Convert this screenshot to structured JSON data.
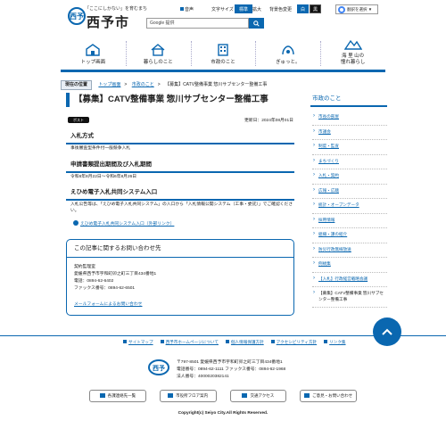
{
  "header": {
    "tagline": "「ここにしかない」を育むまち",
    "site_name": "西予市",
    "logo_text": "西予",
    "toolbar": {
      "voice_label": "音声",
      "text_size_label": "文字サイズ",
      "standard_label": "標準",
      "enlarge_label": "拡大",
      "bg_color_label": "背景色変更",
      "white_label": "白",
      "black_label": "黒",
      "translate_label": "翻訳を選択 ▼"
    },
    "search": {
      "placeholder": "Google 提供"
    }
  },
  "global_nav": [
    {
      "label": "トップ画面",
      "icon": "house-icon"
    },
    {
      "label": "暮らしのこと",
      "icon": "home-icon"
    },
    {
      "label": "市政のこと",
      "icon": "building-icon"
    },
    {
      "label": "ぎゅっと。",
      "icon": "hands-icon"
    },
    {
      "label": "海 里 山の\n憧れ暮らし",
      "icon": "mountain-icon"
    }
  ],
  "breadcrumb": {
    "tag": "現在の位置",
    "items": [
      "トップ画面",
      "市政のこと",
      "【募集】CATV整備事業 惣川サブセンター整備工事"
    ]
  },
  "article": {
    "title": "【募集】CATV整備事業 惣川サブセンター整備工事",
    "post_label": "ポスト",
    "updated": "更新日：2024年08月01日",
    "sections": [
      {
        "heading": "入札方式",
        "body": "事後審査型条件付一般競争入札"
      },
      {
        "heading": "申請書類提出期間及び入札期間",
        "body": "令和6年8月22日～令和6年8月26日"
      },
      {
        "heading": "えひめ電子入札共同システム入口",
        "body": "入札公告等は、「えひめ電子入札共同システム」の入口から「入札情報公開システム（工事・委託）」でご確認ください。"
      }
    ],
    "link_label": "えひめ電子入札共同システム入口（外部リンク）"
  },
  "inquiry": {
    "title": "この記事に関するお問い合わせ先",
    "lines": [
      "契約監理室",
      "愛媛県西予市宇和町卯之町三丁目434番地1",
      "電話：0894-62-6402",
      "ファックス番号：0894-62-6501"
    ],
    "mail_label": "メールフォームによるお問い合わせ"
  },
  "sidebar": {
    "title": "市政のこと",
    "items": [
      "市長の部屋",
      "市議会",
      "制度・監査",
      "まちづくり",
      "入札・契約",
      "広報・広聴",
      "統計・オープンデータ",
      "採用情報",
      "組織・課の紹介",
      "防災行政無線放送",
      "例規集",
      "【入札】行政経営戦略会議",
      "【募集】CATV整備事業 惣川サブセンター整備工事"
    ],
    "current_index": 12
  },
  "footer": {
    "nav": [
      "サイトマップ",
      "西予市ホームページについて",
      "個人情報保護方針",
      "アクセシビリティ方針",
      "リンク集"
    ],
    "logo_text": "西予",
    "address_lines": [
      "〒797-8501 愛媛県西予市宇和町卯之町三丁目434番地1",
      "電話番号：0894-62-1111 ファックス番号：0894-62-1968",
      "法人番号：4000020382141"
    ],
    "buttons": [
      "各課連絡先一覧",
      "市役所フロア案内",
      "交通アクセス",
      "ご意見・お問い合わせ"
    ],
    "copyright": "Copyright(c) Seiyo City.All Rights Reserved."
  },
  "colors": {
    "accent": "#0a67b0"
  }
}
